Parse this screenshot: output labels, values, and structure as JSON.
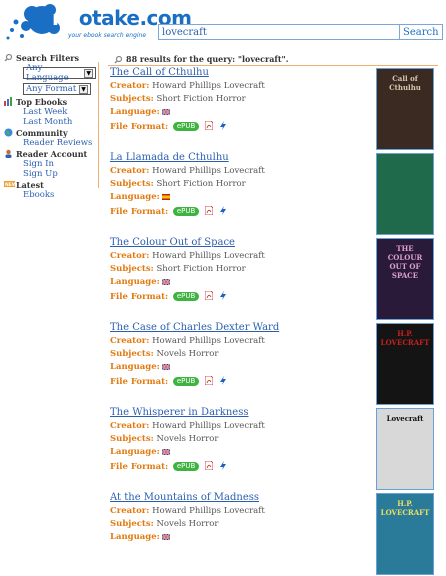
{
  "logo": {
    "prefix": "ne",
    "rest": "otake.com",
    "tagline": "your ebook search engine"
  },
  "search": {
    "query": "lovecraft",
    "button_label": "Search"
  },
  "sidebar": {
    "filters_heading": "Search Filters",
    "language_select": "Any Language",
    "format_select": "Any Format",
    "top_heading": "Top Ebooks",
    "top_links": [
      "Last Week",
      "Last Month"
    ],
    "community_heading": "Community",
    "community_links": [
      "Reader Reviews"
    ],
    "account_heading": "Reader Account",
    "account_links": [
      "Sign In",
      "Sign Up"
    ],
    "latest_heading": "Latest",
    "latest_links": [
      "Ebooks"
    ]
  },
  "results": {
    "summary": "88 results for the query: \"lovecraft\".",
    "labels": {
      "creator": "Creator:",
      "subjects": "Subjects:",
      "language": "Language:",
      "format": "File Format:"
    },
    "epub_label": "ePUB",
    "items": [
      {
        "title": "The Call of Cthulhu",
        "creator": "Howard Phillips Lovecraft",
        "subjects": "Short Fiction Horror",
        "language": "en",
        "show_format": true
      },
      {
        "title": "La Llamada de Cthulhu",
        "creator": "Howard Phillips Lovecraft",
        "subjects": "Short Fiction Horror",
        "language": "es",
        "show_format": true
      },
      {
        "title": "The Colour Out of Space",
        "creator": "Howard Phillips Lovecraft",
        "subjects": "Short Fiction Horror",
        "language": "en",
        "show_format": true
      },
      {
        "title": "The Case of Charles Dexter Ward",
        "creator": "Howard Phillips Lovecraft",
        "subjects": "Novels Horror",
        "language": "en",
        "show_format": true
      },
      {
        "title": "The Whisperer in Darkness",
        "creator": "Howard Phillips Lovecraft",
        "subjects": "Novels Horror",
        "language": "en",
        "show_format": true
      },
      {
        "title": "At the Mountains of Madness",
        "creator": "Howard Phillips Lovecraft",
        "subjects": "Novels Horror",
        "language": "en",
        "show_format": false
      }
    ]
  },
  "covers": [
    {
      "text": "Call of Cthulhu",
      "bg": "#3a2a22",
      "fg": "#d8c8b0"
    },
    {
      "text": "",
      "bg": "#1e6a4a",
      "fg": "#a8e0c0"
    },
    {
      "text": "THE COLOUR OUT OF SPACE",
      "bg": "#2a1a3a",
      "fg": "#e0a0d0"
    },
    {
      "text": "H.P. LOVECRAFT",
      "bg": "#141414",
      "fg": "#c82020"
    },
    {
      "text": "Lovecraft",
      "bg": "#d8d8d8",
      "fg": "#111"
    },
    {
      "text": "H.P. LOVECRAFT",
      "bg": "#2a7a9a",
      "fg": "#f0e060"
    }
  ]
}
